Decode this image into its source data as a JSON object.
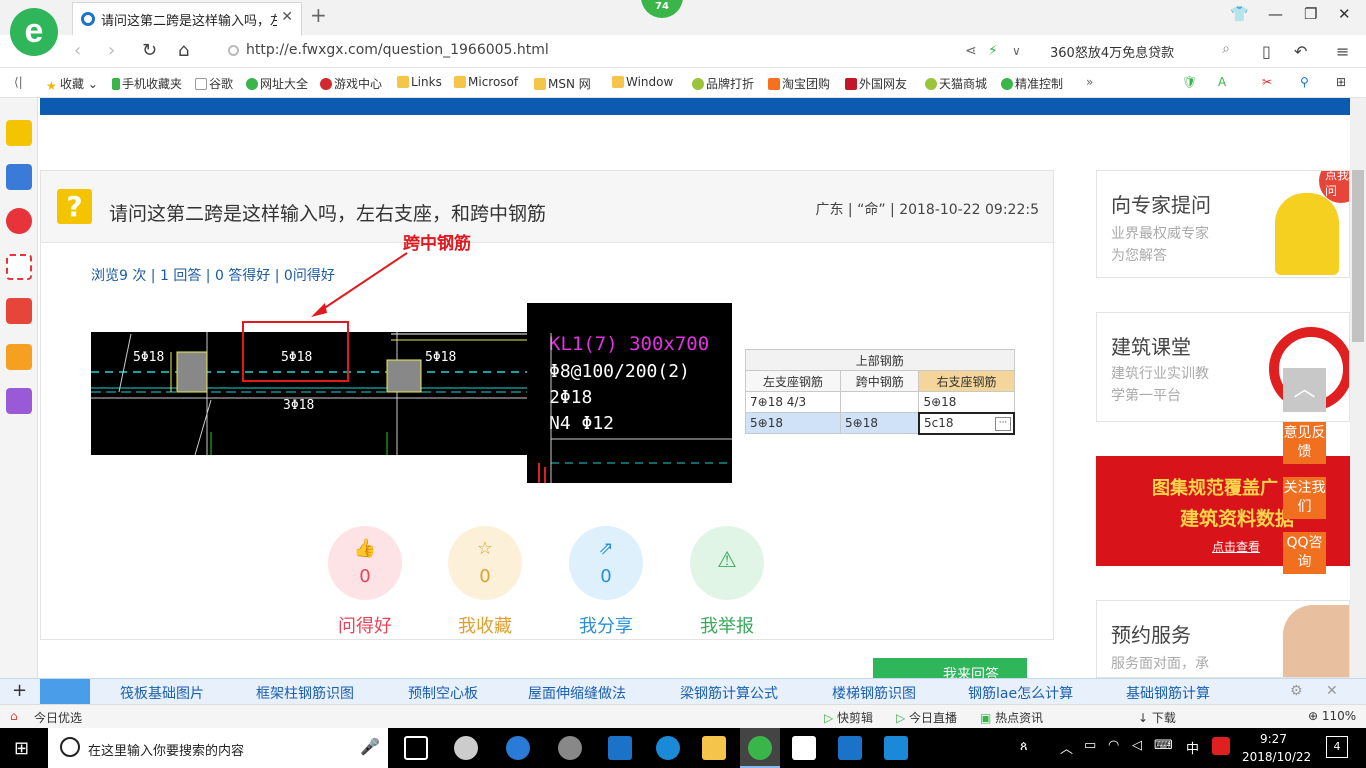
{
  "browser": {
    "tab_title": "请问这第二跨是这样输入吗，左右",
    "badge": "74",
    "url": "http://e.fwxgx.com/question_1966005.html",
    "search_text": "360怒放4万免息贷款"
  },
  "bookmarks": [
    "收藏",
    "手机收藏夹",
    "谷歌",
    "网址大全",
    "游戏中心",
    "Links",
    "Microsof",
    "MSN 网",
    "Window",
    "品牌打折",
    "淘宝团购",
    "外国网友",
    "天猫商城",
    "精准控制"
  ],
  "question": {
    "icon": "?",
    "title": "请问这第二跨是这样输入吗，左右支座，和跨中钢筋",
    "meta": "广东 |  “命”  | 2018-10-22 09:22:5",
    "stats": "浏览9 次 | 1 回答 | 0 答得好 | 0问得好",
    "annotation": "跨中钢筋"
  },
  "cad1": {
    "left_label": "5Φ18",
    "mid_label": "5Φ18",
    "right_label": "5Φ18",
    "bottom_label": "3Φ18"
  },
  "cad2": {
    "line1": "KL1(7) 300x700",
    "line2": "Φ8@100/200(2)",
    "line3": "2Φ18",
    "line4": "N4 Φ12"
  },
  "grid": {
    "group_header": "上部钢筋",
    "headers": [
      "左支座钢筋",
      "跨中钢筋",
      "右支座钢筋"
    ],
    "rows": [
      [
        "7⊕18 4/3",
        "",
        "5⊕18"
      ],
      [
        "5⊕18",
        "5⊕18",
        "5c18"
      ]
    ]
  },
  "actions": [
    {
      "label": "问得好",
      "count": "0",
      "color": "#e8455a",
      "bg": "#fde3e6"
    },
    {
      "label": "我收藏",
      "count": "0",
      "color": "#e0a030",
      "bg": "#fdf0d8"
    },
    {
      "label": "我分享",
      "count": "0",
      "color": "#2a8fd8",
      "bg": "#ddf0fc"
    },
    {
      "label": "我举报",
      "count": "",
      "color": "#3aaa5a",
      "bg": "#e0f5e6"
    }
  ],
  "answer_button": "我来回答",
  "right": {
    "expert": {
      "title": "向专家提问",
      "desc1": "业界最权威专家",
      "desc2": "为您解答",
      "bubble": "点我提问"
    },
    "class": {
      "title": "建筑课堂",
      "desc1": "建筑行业实训教",
      "desc2": "学第一平台"
    },
    "banner": {
      "line1": "图集规范覆盖广",
      "line2": "建筑资料数据",
      "link": "点击查看"
    },
    "service": {
      "title": "预约服务",
      "desc1": "服务面对面，承"
    },
    "float": [
      "意见反馈",
      "关注我们",
      "QQ咨询"
    ]
  },
  "hot_links": [
    "筏板基础图片",
    "框架柱钢筋识图",
    "预制空心板",
    "屋面伸缩缝做法",
    "梁钢筋计算公式",
    "楼梯钢筋识图",
    "钢筋lae怎么计算",
    "基础钢筋计算"
  ],
  "status": {
    "left": "今日优选",
    "items": [
      "快剪辑",
      "今日直播",
      "热点资讯",
      "下载"
    ],
    "zoom": "110%"
  },
  "taskbar": {
    "search_placeholder": "在这里输入你要搜索的内容",
    "time": "9:27",
    "date": "2018/10/22",
    "lang": "中",
    "notif": "4"
  }
}
